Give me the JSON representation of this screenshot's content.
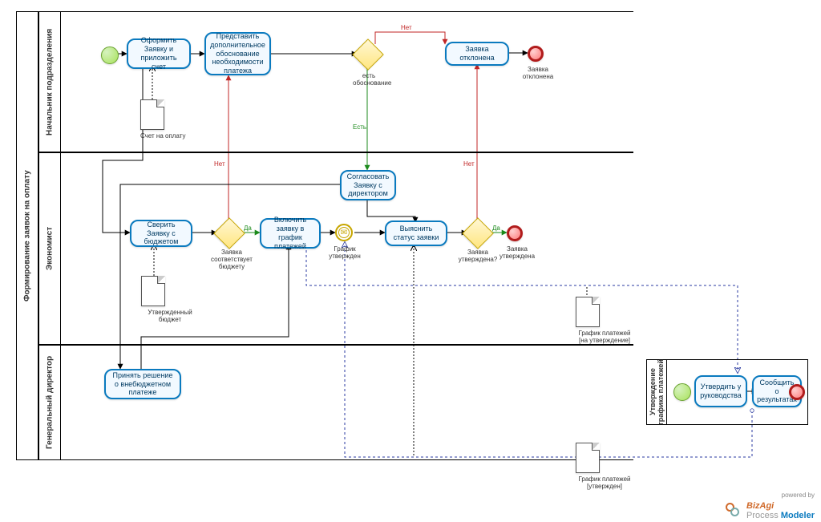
{
  "pool": {
    "title": "Формирование заявок на оплату",
    "lanes": {
      "lane1": "Начальник подразделения",
      "lane2": "Экономист",
      "lane3": "Генеральный директор"
    }
  },
  "sub_pool": {
    "title": "Утверждение графика платежей"
  },
  "tasks": {
    "t1": "Оформить Заявку и приложить счет",
    "t2": "Представить дополнительное обоснование необходимости платежа",
    "t3": "Заявка отклонена",
    "t4": "Сверить Заявку с бюджетом",
    "t5": "Включить заявку в график платежей",
    "t6": "Выяснить статус заявки",
    "t7": "Согласовать Заявку с директором",
    "t8": "Принять решение о внебюджетном платеже",
    "t9": "Утвердить у руководства",
    "t10": "Сообщить о результатах"
  },
  "gateway_labels": {
    "g1": "есть обоснование",
    "g2": "Заявка соответствует бюджету",
    "g3": "Заявка утверждена?"
  },
  "event_labels": {
    "end1": "Заявка отклонена",
    "interm1": "График утвержден",
    "end2": "Заявка утверждена"
  },
  "flow_labels": {
    "f_no1": "Нет",
    "f_yes1": "Есть",
    "f_no2": "Нет",
    "f_yes2": "Да",
    "f_no3": "Нет",
    "f_yes3": "Да"
  },
  "data_objects": {
    "d1": "Счет на оплату",
    "d2": "Утвержденный бюджет",
    "d3": "График платежей [на утверждение]",
    "d4": "График платежей [утвержден]"
  },
  "footer": {
    "powered": "powered by",
    "biz": "BizAgi",
    "pm": "Process ",
    "modeler": "Modeler"
  }
}
